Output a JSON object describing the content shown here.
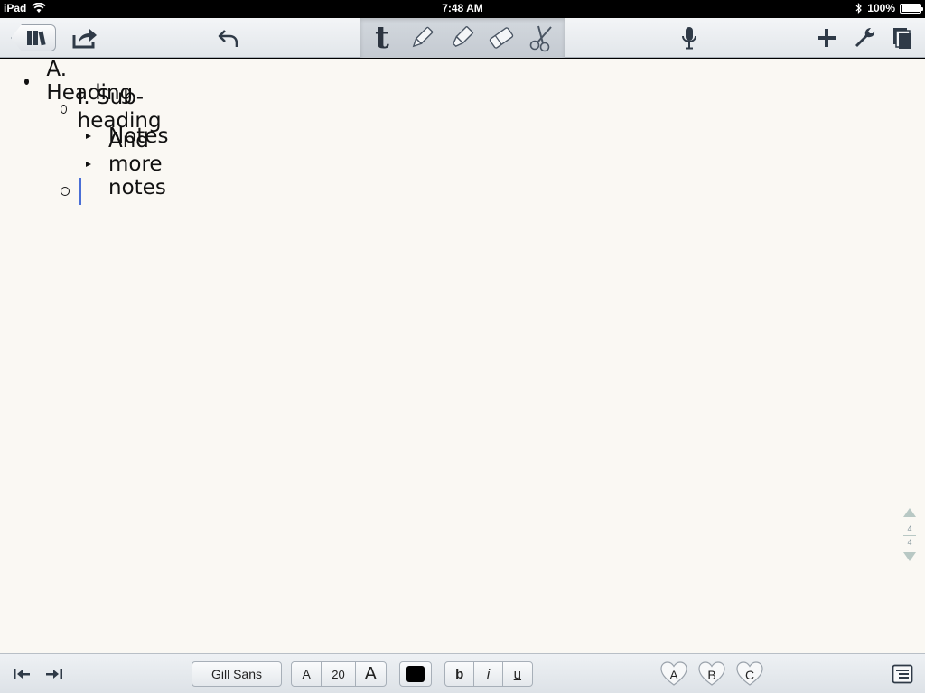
{
  "status": {
    "device": "iPad",
    "time": "7:48 AM",
    "battery": "100%",
    "battery_level": 1.0
  },
  "toolbar": {
    "icons": [
      "library-icon",
      "share-icon",
      "undo-icon",
      "text-tool-icon",
      "pen-icon",
      "highlighter-icon",
      "eraser-icon",
      "scissors-icon",
      "microphone-icon",
      "add-icon",
      "wrench-icon",
      "pages-icon"
    ],
    "text_tool_glyph": "t"
  },
  "outline": {
    "items": [
      {
        "level": 1,
        "bullet": "dot",
        "text": "A. Heading"
      },
      {
        "level": 2,
        "bullet": "circle",
        "text": "I. Sub-heading"
      },
      {
        "level": 3,
        "bullet": "triangle",
        "text": "Notes"
      },
      {
        "level": 3,
        "bullet": "triangle",
        "text": "And more notes"
      },
      {
        "level": 2,
        "bullet": "circle",
        "text": ""
      }
    ]
  },
  "pager": {
    "current": "4",
    "total": "4"
  },
  "bottombar": {
    "font_name": "Gill Sans",
    "size_decrease": "A",
    "font_size": "20",
    "size_increase": "A",
    "text_color": "#000000",
    "bold": "b",
    "italic": "i",
    "underline": "u",
    "tags": [
      "A",
      "B",
      "C"
    ]
  },
  "colors": {
    "accent_cursor": "#4a6fd6",
    "paper": "#faf8f3",
    "toolbar": "#e2e6ea"
  }
}
